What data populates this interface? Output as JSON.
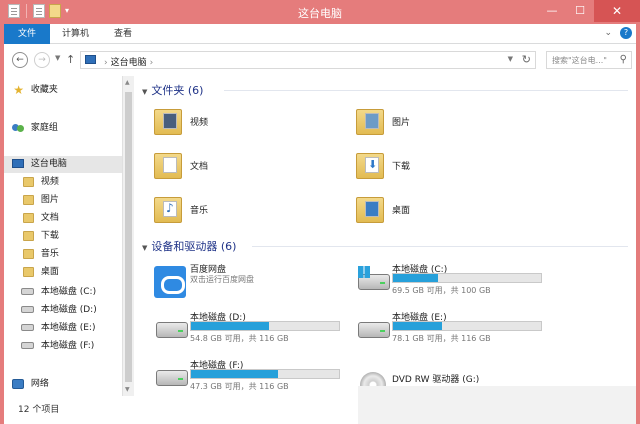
{
  "window": {
    "title": "这台电脑"
  },
  "ribbon": {
    "tabs": [
      "文件",
      "计算机",
      "查看"
    ]
  },
  "address": {
    "path": "这台电脑",
    "search_placeholder": "搜索\"这台电...\""
  },
  "nav": {
    "items": [
      {
        "label": "收藏夹",
        "icon": "star-icon"
      },
      {
        "label": "家庭组",
        "icon": "homegroup-icon"
      },
      {
        "label": "这台电脑",
        "icon": "computer-icon"
      },
      {
        "label": "视频",
        "icon": "folder-icon"
      },
      {
        "label": "图片",
        "icon": "folder-icon"
      },
      {
        "label": "文档",
        "icon": "folder-icon"
      },
      {
        "label": "下载",
        "icon": "folder-icon"
      },
      {
        "label": "音乐",
        "icon": "folder-icon"
      },
      {
        "label": "桌面",
        "icon": "folder-icon"
      },
      {
        "label": "本地磁盘 (C:)",
        "icon": "drive-icon"
      },
      {
        "label": "本地磁盘 (D:)",
        "icon": "drive-icon"
      },
      {
        "label": "本地磁盘 (E:)",
        "icon": "drive-icon"
      },
      {
        "label": "本地磁盘 (F:)",
        "icon": "drive-icon"
      },
      {
        "label": "网络",
        "icon": "network-icon"
      }
    ]
  },
  "folders": {
    "header": "文件夹 (6)",
    "items": [
      {
        "label": "视频"
      },
      {
        "label": "图片"
      },
      {
        "label": "文档"
      },
      {
        "label": "下载"
      },
      {
        "label": "音乐"
      },
      {
        "label": "桌面"
      }
    ]
  },
  "devices": {
    "header": "设备和驱动器 (6)",
    "items": [
      {
        "name": "百度网盘",
        "sub": "双击运行百度网盘"
      },
      {
        "name": "本地磁盘 (C:)",
        "sub": "69.5 GB 可用，共 100 GB",
        "used_fraction": 0.305
      },
      {
        "name": "本地磁盘 (D:)",
        "sub": "54.8 GB 可用，共 116 GB",
        "used_fraction": 0.53
      },
      {
        "name": "本地磁盘 (E:)",
        "sub": "78.1 GB 可用，共 116 GB",
        "used_fraction": 0.33
      },
      {
        "name": "本地磁盘 (F:)",
        "sub": "47.3 GB 可用，共 116 GB",
        "used_fraction": 0.59
      },
      {
        "name": "DVD RW 驱动器 (G:)"
      }
    ]
  },
  "status": {
    "item_count": "12 个项目"
  }
}
